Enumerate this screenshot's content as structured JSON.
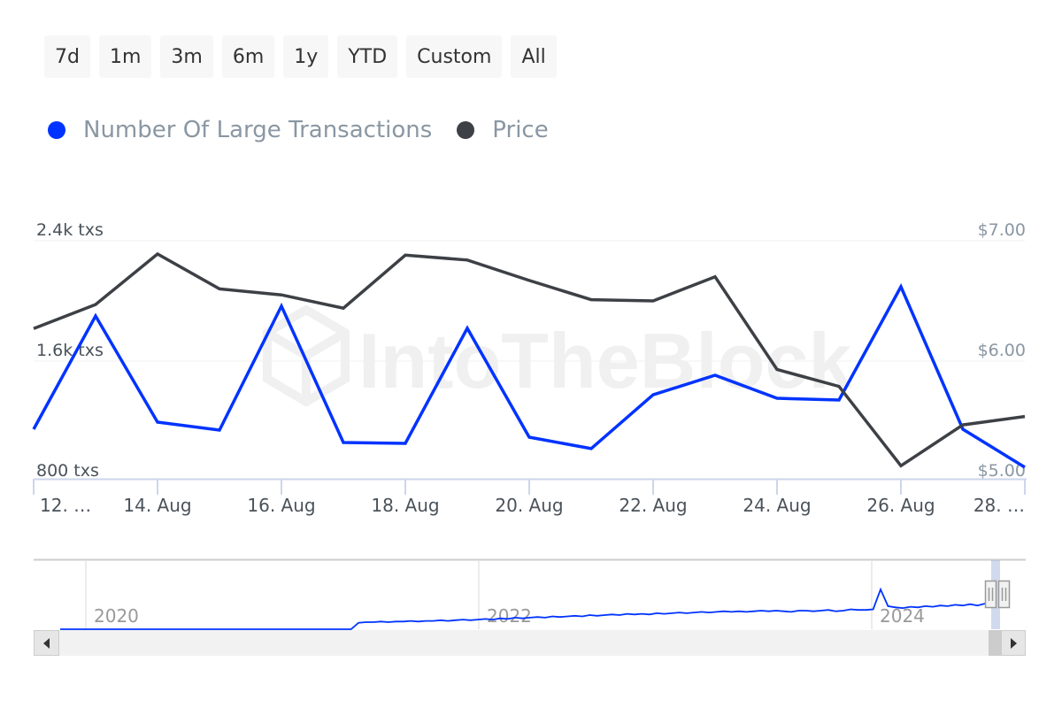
{
  "range_selector": {
    "buttons": [
      "7d",
      "1m",
      "3m",
      "6m",
      "1y",
      "YTD",
      "Custom",
      "All"
    ]
  },
  "legend": {
    "items": [
      {
        "label": "Number Of Large Transactions",
        "color": "#0033ff"
      },
      {
        "label": "Price",
        "color": "#3d4045"
      }
    ]
  },
  "watermark": "IntoTheBlock",
  "chart_data": {
    "type": "line",
    "title": "",
    "xlabel": "",
    "x": [
      "12 Aug",
      "13 Aug",
      "14 Aug",
      "15 Aug",
      "16 Aug",
      "17 Aug",
      "18 Aug",
      "19 Aug",
      "20 Aug",
      "21 Aug",
      "22 Aug",
      "23 Aug",
      "24 Aug",
      "25 Aug",
      "26 Aug",
      "27 Aug",
      "28 Aug"
    ],
    "x_tick_labels": [
      "12. …",
      "14. Aug",
      "16. Aug",
      "18. Aug",
      "20. Aug",
      "22. Aug",
      "24. Aug",
      "26. Aug",
      "28. …"
    ],
    "series": [
      {
        "name": "Number Of Large Transactions",
        "axis": "left",
        "color": "#0033ff",
        "values": [
          1147,
          1900,
          1194,
          1141,
          1965,
          1059,
          1053,
          1818,
          1094,
          1018,
          1376,
          1506,
          1353,
          1341,
          2094,
          1147,
          894
        ]
      },
      {
        "name": "Price",
        "axis": "right",
        "color": "#3d4045",
        "values": [
          6.27,
          6.47,
          6.89,
          6.6,
          6.55,
          6.44,
          6.88,
          6.84,
          6.67,
          6.51,
          6.5,
          6.7,
          5.93,
          5.79,
          5.13,
          5.47,
          5.54
        ]
      }
    ],
    "y_left": {
      "ticks": [
        800,
        1600,
        2400
      ],
      "tick_labels": [
        "800 txs",
        "1.6k txs",
        "2.4k txs"
      ],
      "range": [
        800,
        2400
      ]
    },
    "y_right": {
      "ticks": [
        5,
        6,
        7
      ],
      "tick_labels": [
        "$5.00",
        "$6.00",
        "$7.00"
      ],
      "range": [
        5,
        7
      ]
    },
    "grid": true,
    "legend_position": "top-left",
    "navigator": {
      "year_labels": [
        "2020",
        "2022",
        "2024"
      ],
      "series_name": "Number Of Large Transactions",
      "values": [
        0,
        0,
        0,
        0,
        0,
        0,
        0,
        0,
        0,
        0,
        0,
        0,
        0,
        0,
        0,
        0,
        0,
        0,
        0,
        0,
        0,
        0,
        0,
        0,
        0,
        0,
        0,
        0,
        0,
        0,
        0,
        0,
        0,
        0,
        0,
        0,
        0,
        0,
        0,
        0,
        0.1,
        0.11,
        0.11,
        0.12,
        0.11,
        0.12,
        0.12,
        0.13,
        0.12,
        0.13,
        0.13,
        0.14,
        0.13,
        0.14,
        0.15,
        0.14,
        0.15,
        0.16,
        0.15,
        0.17,
        0.16,
        0.18,
        0.17,
        0.18,
        0.19,
        0.18,
        0.2,
        0.19,
        0.2,
        0.21,
        0.2,
        0.22,
        0.21,
        0.22,
        0.23,
        0.22,
        0.24,
        0.23,
        0.24,
        0.23,
        0.25,
        0.24,
        0.25,
        0.26,
        0.25,
        0.26,
        0.27,
        0.26,
        0.27,
        0.28,
        0.27,
        0.28,
        0.27,
        0.28,
        0.29,
        0.28,
        0.29,
        0.28,
        0.27,
        0.29,
        0.29,
        0.28,
        0.29,
        0.3,
        0.28,
        0.29,
        0.31,
        0.3,
        0.3,
        0.31,
        0.62,
        0.36,
        0.34,
        0.33,
        0.35,
        0.34,
        0.36,
        0.35,
        0.37,
        0.36,
        0.38,
        0.37,
        0.39,
        0.37,
        0.4
      ],
      "selected_range": "last 17 days"
    }
  }
}
